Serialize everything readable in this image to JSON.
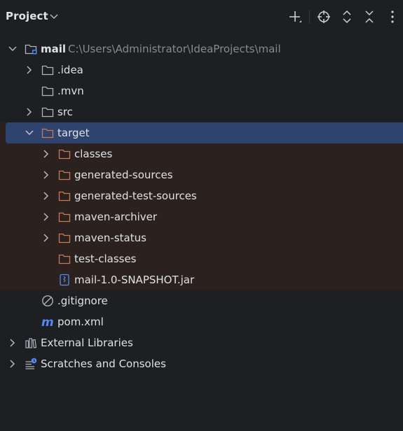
{
  "header": {
    "title": "Project",
    "title_dropdown_icon": "chevron-down-icon",
    "actions": [
      {
        "name": "add-button",
        "icon": "plus-icon"
      },
      {
        "name": "locate-button",
        "icon": "crosshair-icon"
      },
      {
        "name": "expand-all-button",
        "icon": "expand-icon"
      },
      {
        "name": "collapse-all-button",
        "icon": "collapse-icon"
      },
      {
        "name": "options-button",
        "icon": "more-vertical-icon"
      }
    ]
  },
  "tree": {
    "root": {
      "label": "mail",
      "path": "C:\\Users\\Administrator\\IdeaProjects\\mail"
    },
    "idea": {
      "label": ".idea"
    },
    "mvn": {
      "label": ".mvn"
    },
    "src": {
      "label": "src"
    },
    "target": {
      "label": "target"
    },
    "classes": {
      "label": "classes"
    },
    "generated_sources": {
      "label": "generated-sources"
    },
    "generated_test_sources": {
      "label": "generated-test-sources"
    },
    "maven_archiver": {
      "label": "maven-archiver"
    },
    "maven_status": {
      "label": "maven-status"
    },
    "test_classes": {
      "label": "test-classes"
    },
    "jar": {
      "label": "mail-1.0-SNAPSHOT.jar"
    },
    "gitignore": {
      "label": ".gitignore"
    },
    "pom": {
      "label": "pom.xml"
    },
    "external_libraries": {
      "label": "External Libraries"
    },
    "scratches": {
      "label": "Scratches and Consoles"
    }
  },
  "colors": {
    "background": "#1e1f22",
    "selection": "#2e436e",
    "excluded_background": "#2b2220",
    "folder_gray": "#aeb3bc",
    "folder_excluded": "#c87a55",
    "path_gray": "#868a91",
    "maven_blue": "#548af7"
  }
}
